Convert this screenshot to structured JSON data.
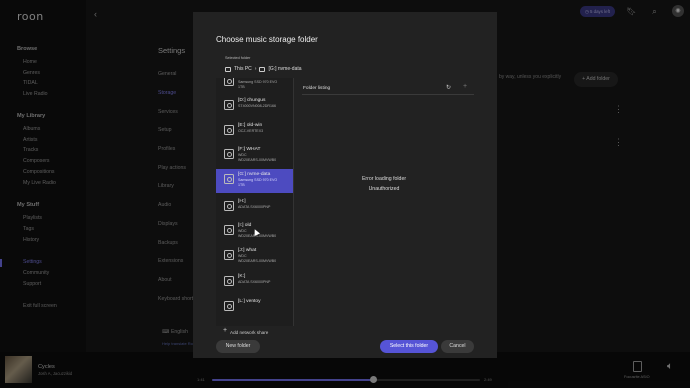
{
  "app": {
    "logo": "roon"
  },
  "topbar": {
    "trial": "◷ 5 days left"
  },
  "sidebar": {
    "browse_heading": "Browse",
    "browse_items": [
      "Home",
      "Genres",
      "TIDAL",
      "Live Radio"
    ],
    "library_heading": "My Library",
    "library_items": [
      "Albums",
      "Artists",
      "Tracks",
      "Composers",
      "Compositions",
      "My Live Radio"
    ],
    "stuff_heading": "My Stuff",
    "stuff_items": [
      "Playlists",
      "Tags",
      "History"
    ],
    "bottom_items": [
      "Settings",
      "Community",
      "Support"
    ],
    "exit": "Exit full screen"
  },
  "settings": {
    "title": "Settings",
    "nav": [
      "General",
      "Storage",
      "Services",
      "Setup",
      "Profiles",
      "Play actions",
      "Library",
      "Audio",
      "Displays",
      "Backups",
      "Extensions",
      "About",
      "Keyboard short"
    ],
    "language": "English",
    "help_link": "Help translate Roon",
    "background_text": "by way, unless you explicitly",
    "add_folder": "+ Add folder"
  },
  "dialog": {
    "title": "Choose music storage folder",
    "selected_label": "Selected folder",
    "breadcrumb": [
      "This PC",
      "[G:] nvme-data"
    ],
    "drives": [
      {
        "name": "[C:] nvme-win",
        "sub": "Samsung SSD 970 EVO\n1TB",
        "selected": false
      },
      {
        "name": "[D:] chungus",
        "sub": "ST4000VN008-2DR166",
        "selected": false
      },
      {
        "name": "[E:] old-win",
        "sub": "OCZ-VERTEX3",
        "selected": false
      },
      {
        "name": "[F:] WHAT",
        "sub": "WDC\nWD20EARS-00MVWB0",
        "selected": false
      },
      {
        "name": "[G:] nvme-data",
        "sub": "Samsung SSD 970 EVO\n1TB",
        "selected": true
      },
      {
        "name": "[H:]",
        "sub": "ADATA SX6000PNP",
        "selected": false
      },
      {
        "name": "[I:] old",
        "sub": "WDC\nWD20EARS-00MVWB0",
        "selected": false
      },
      {
        "name": "[J:] what",
        "sub": "WDC\nWD20EARS-00MVWB0",
        "selected": false
      },
      {
        "name": "[K:]",
        "sub": "ADATA SX6000PNP",
        "selected": false
      },
      {
        "name": "[L:] ventoy",
        "sub": "",
        "selected": false
      }
    ],
    "add_network_share": "Add network share",
    "folder_listing": "Folder listing",
    "error_line1": "Error loading folder",
    "error_line2": "Unauthorized",
    "new_folder": "New folder",
    "select_folder": "Select this folder",
    "cancel": "Cancel"
  },
  "player": {
    "track": "Cycles",
    "artist": "Josh A, Jacuzzikid",
    "elapsed": "1:41",
    "total": "2:49",
    "progress": 0.6,
    "zone": "Focusrite ASIO"
  },
  "colors": {
    "accent": "#5654d6",
    "selected_row": "#4d4bc0"
  }
}
